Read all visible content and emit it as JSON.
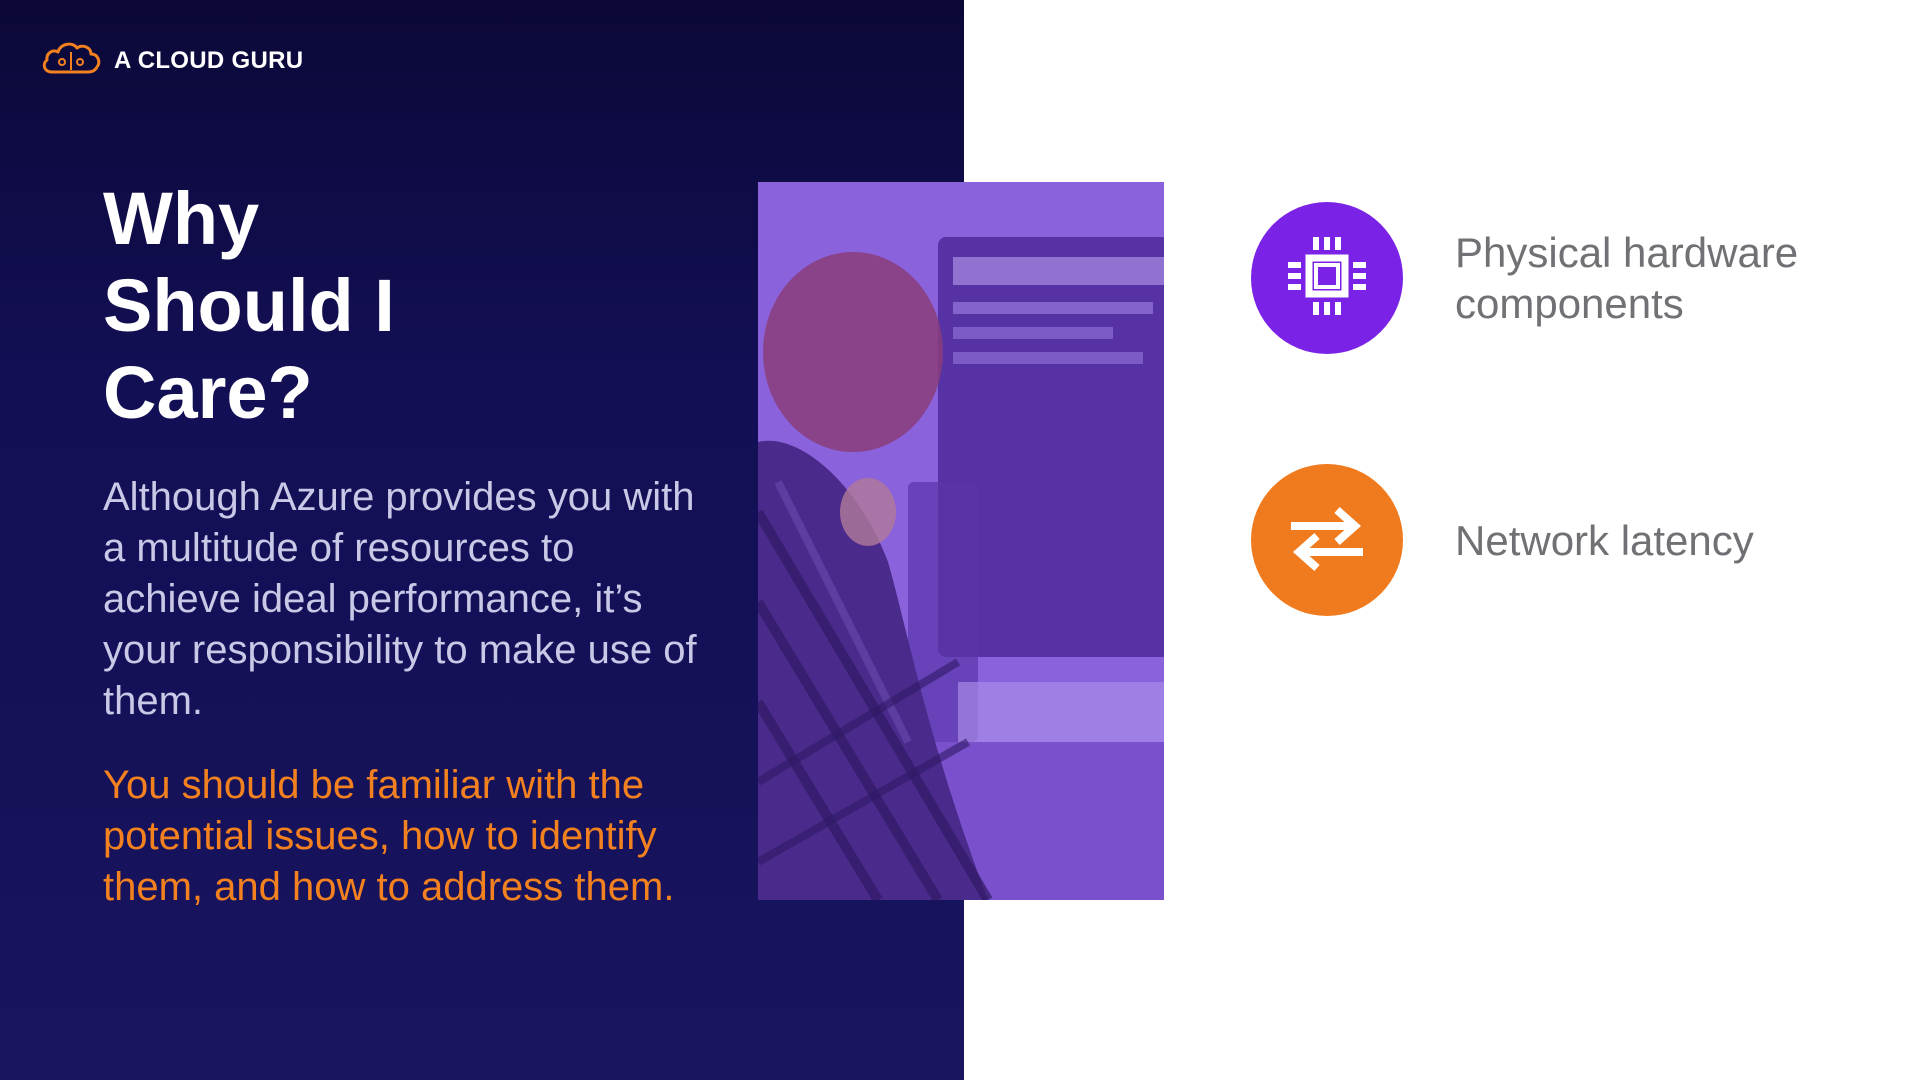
{
  "brand": {
    "name": "A CLOUD GURU",
    "logo_icon": "cloud-icon",
    "logo_color": "#f3811f"
  },
  "slide": {
    "title_lines": [
      "Why",
      "Should I",
      "Care?"
    ],
    "body": "Although Azure provides you with a multitude of resources to achieve ideal performance, it’s your responsibility to make use of them.",
    "highlight": "You should be familiar with the potential issues, how to identify them, and how to address them.",
    "photo_icon": "person-at-computer-photo"
  },
  "items": [
    {
      "label": "Physical hardware components",
      "icon": "cpu-chip-icon",
      "color": "#7a23e6"
    },
    {
      "label": "Network latency",
      "icon": "transfer-arrows-icon",
      "color": "#f07a1e"
    }
  ],
  "colors": {
    "panel_dark": "#130f55",
    "text_light": "#c9c8e6",
    "accent_orange": "#f3811f",
    "label_gray": "#707075"
  }
}
